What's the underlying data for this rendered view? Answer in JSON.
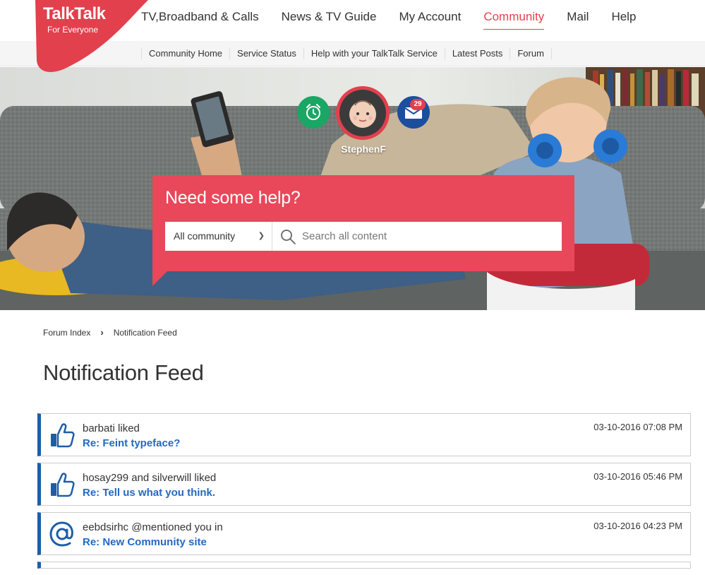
{
  "brand": {
    "name": "TalkTalk",
    "tagline": "For Everyone",
    "color": "#e2404d"
  },
  "main_nav": {
    "items": [
      {
        "label": "TV,Broadband & Calls"
      },
      {
        "label": "News & TV Guide"
      },
      {
        "label": "My Account"
      },
      {
        "label": "Community",
        "active": true
      },
      {
        "label": "Mail"
      },
      {
        "label": "Help"
      }
    ]
  },
  "sub_nav": {
    "items": [
      {
        "label": "Community Home"
      },
      {
        "label": "Service Status"
      },
      {
        "label": "Help with your TalkTalk Service"
      },
      {
        "label": "Latest Posts"
      },
      {
        "label": "Forum"
      }
    ]
  },
  "user": {
    "name": "StephenF",
    "mail_count": "29"
  },
  "help": {
    "title": "Need some help?",
    "scope": "All community",
    "search_placeholder": "Search all content"
  },
  "breadcrumb": {
    "root": "Forum Index",
    "current": "Notification Feed"
  },
  "page": {
    "title": "Notification Feed"
  },
  "feed": [
    {
      "icon": "thumbs-up-icon",
      "actor": "barbati liked",
      "link": "Re: Feint typeface?",
      "time": "03-10-2016 07:08 PM"
    },
    {
      "icon": "thumbs-up-icon",
      "actor": "hosay299 and silverwill liked",
      "link": "Re: Tell us what you think.",
      "time": "03-10-2016 05:46 PM"
    },
    {
      "icon": "at-mention-icon",
      "actor": "eebdsirhc @mentioned you in",
      "link": "Re: New Community site",
      "time": "03-10-2016 04:23 PM"
    }
  ]
}
